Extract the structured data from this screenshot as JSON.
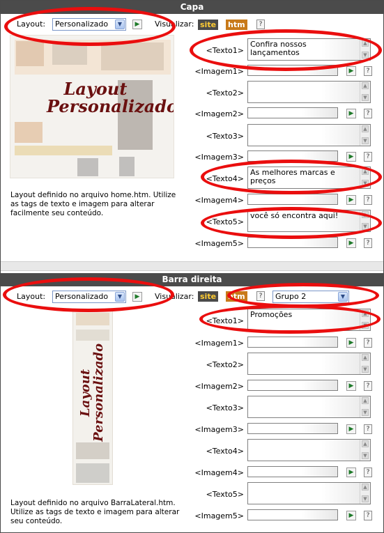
{
  "sections": [
    {
      "title": "Capa",
      "layout_label": "Layout:",
      "layout_value": "Personalizado",
      "visualizar_label": "Visualizar:",
      "site_tag": "site",
      "htm_tag": "htm",
      "help_glyph": "?",
      "preview_text": "Layout Personalizado",
      "description": "Layout definido no arquivo home.htm. Utilize as tags de texto e imagem para alterar facilmente seu conteúdo.",
      "fields": [
        {
          "label": "<Texto1>",
          "value": "Confira nossos lançamentos"
        },
        {
          "label": "<Imagem1>"
        },
        {
          "label": "<Texto2>",
          "value": ""
        },
        {
          "label": "<Imagem2>"
        },
        {
          "label": "<Texto3>",
          "value": ""
        },
        {
          "label": "<Imagem3>"
        },
        {
          "label": "<Texto4>",
          "value": "As melhores marcas e preços"
        },
        {
          "label": "<Imagem4>"
        },
        {
          "label": "<Texto5>",
          "value": "você só encontra aqui!"
        },
        {
          "label": "<Imagem5>"
        }
      ]
    },
    {
      "title": "Barra direita",
      "layout_label": "Layout:",
      "layout_value": "Personalizado",
      "visualizar_label": "Visualizar:",
      "site_tag": "site",
      "htm_tag": "htm",
      "group_value": "Grupo 2",
      "help_glyph": "?",
      "preview_text": "Layout Personalizado",
      "description": "Layout definido no arquivo BarraLateral.htm. Utilize as tags de texto e imagem para alterar seu conteúdo.",
      "fields": [
        {
          "label": "<Texto1>",
          "value": "Promoções"
        },
        {
          "label": "<Imagem1>"
        },
        {
          "label": "<Texto2>",
          "value": ""
        },
        {
          "label": "<Imagem2>"
        },
        {
          "label": "<Texto3>",
          "value": ""
        },
        {
          "label": "<Imagem3>"
        },
        {
          "label": "<Texto4>",
          "value": ""
        },
        {
          "label": "<Imagem4>"
        },
        {
          "label": "<Texto5>",
          "value": ""
        },
        {
          "label": "<Imagem5>"
        }
      ]
    }
  ],
  "icons": {
    "dropdown": "chevron-down-icon",
    "go": "play-arrow-icon",
    "help": "help-icon"
  },
  "colors": {
    "header_bg": "#4b4b4b",
    "annotation": "#ea0e0e",
    "site_tag": "#ffcc33",
    "htm_tag": "#c87a1a"
  }
}
